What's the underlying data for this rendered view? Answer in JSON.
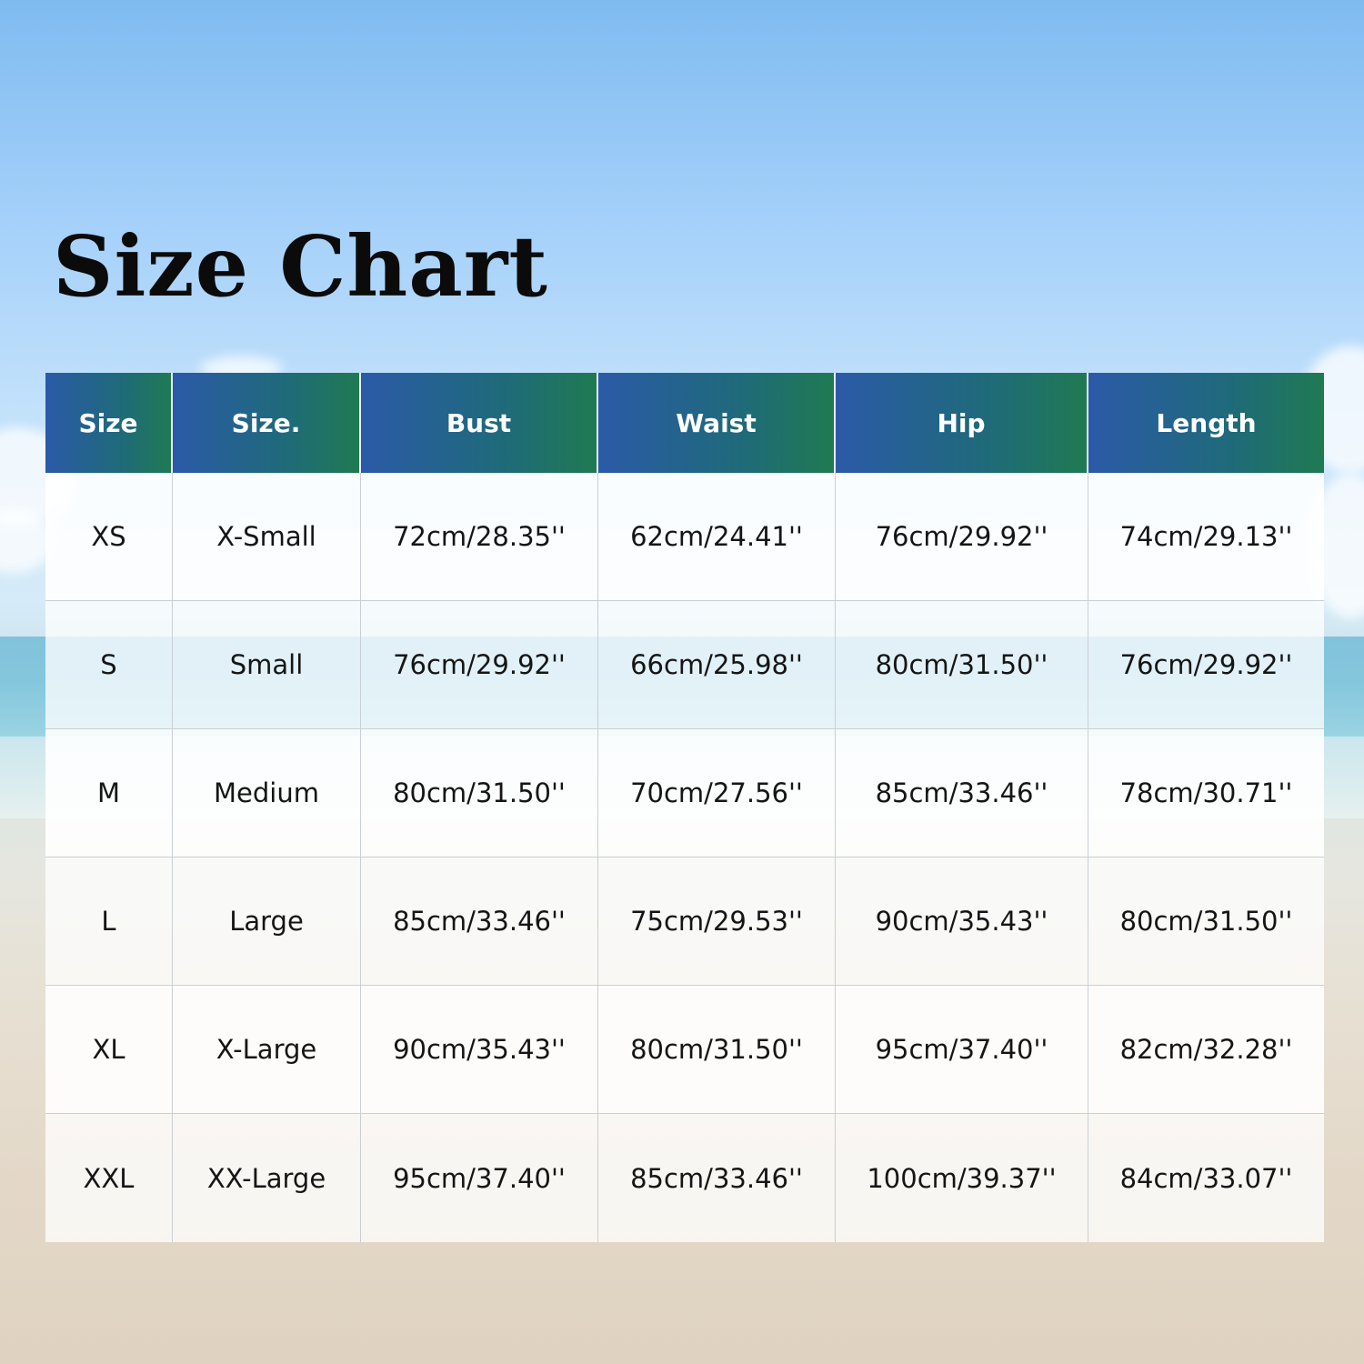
{
  "title": "Size Chart",
  "colors": {
    "header_gradient_start": "#2b5aa8",
    "header_gradient_end": "#1f7a52",
    "header_text": "#ffffff",
    "cell_background": "#ffffff",
    "cell_text": "#151515",
    "grid_line": "#c9cfd4"
  },
  "chart_data": {
    "type": "table",
    "title": "Size Chart",
    "columns": [
      "Size",
      "Size.",
      "Bust",
      "Waist",
      "Hip",
      "Length"
    ],
    "rows": [
      [
        "XS",
        "X-Small",
        "72cm/28.35''",
        "62cm/24.41''",
        "76cm/29.92''",
        "74cm/29.13''"
      ],
      [
        "S",
        "Small",
        "76cm/29.92''",
        "66cm/25.98''",
        "80cm/31.50''",
        "76cm/29.92''"
      ],
      [
        "M",
        "Medium",
        "80cm/31.50''",
        "70cm/27.56''",
        "85cm/33.46''",
        "78cm/30.71''"
      ],
      [
        "L",
        "Large",
        "85cm/33.46''",
        "75cm/29.53''",
        "90cm/35.43''",
        "80cm/31.50''"
      ],
      [
        "XL",
        "X-Large",
        "90cm/35.43''",
        "80cm/31.50''",
        "95cm/37.40''",
        "82cm/32.28''"
      ],
      [
        "XXL",
        "XX-Large",
        "95cm/37.40''",
        "85cm/33.46''",
        "100cm/39.37''",
        "84cm/33.07''"
      ]
    ]
  }
}
